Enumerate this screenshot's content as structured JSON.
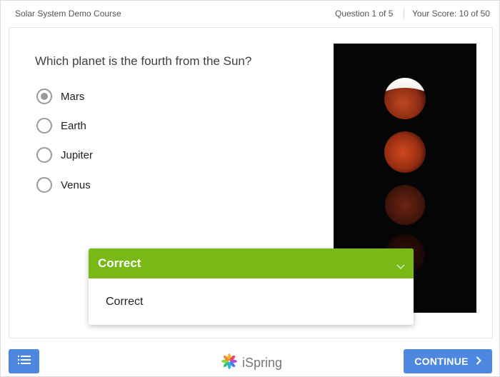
{
  "header": {
    "course_title": "Solar System Demo Course",
    "question_counter": "Question 1 of 5",
    "score": "Your Score: 10 of 50"
  },
  "question": {
    "text": "Which planet is the fourth from the Sun?",
    "options": [
      {
        "label": "Mars",
        "selected": true
      },
      {
        "label": "Earth",
        "selected": false
      },
      {
        "label": "Jupiter",
        "selected": false
      },
      {
        "label": "Venus",
        "selected": false
      }
    ]
  },
  "feedback": {
    "title": "Correct",
    "message": "Correct",
    "color": "#78b817"
  },
  "footer": {
    "logo_text": "iSpring",
    "continue_label": "CONTINUE",
    "button_color": "#4e87e0"
  },
  "icons": [
    "menu-list-icon",
    "ispring-logo-icon",
    "chevron-right-icon",
    "chevron-down-icon"
  ]
}
